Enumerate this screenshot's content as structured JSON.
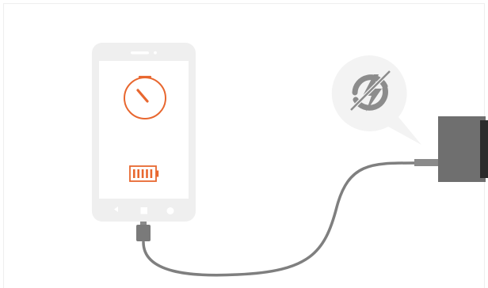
{
  "scene": {
    "description_items": [],
    "colors": {
      "phone_body": "#efefef",
      "phone_screen": "#ffffff",
      "accent": "#e8672f",
      "cable": "#7f7f7f",
      "charger_body": "#6f6f6f",
      "bubble": "#f3f3f3",
      "badge_icon": "#8c8c8c"
    },
    "icons": {
      "timer": "stopwatch-icon",
      "battery": "battery-full-icon",
      "fast_charge": "fast-charge-disabled-icon",
      "nav_back": "triangle-back-icon",
      "nav_home": "square-home-icon",
      "nav_recent": "circle-recent-icon"
    },
    "battery_level": 1.0
  }
}
